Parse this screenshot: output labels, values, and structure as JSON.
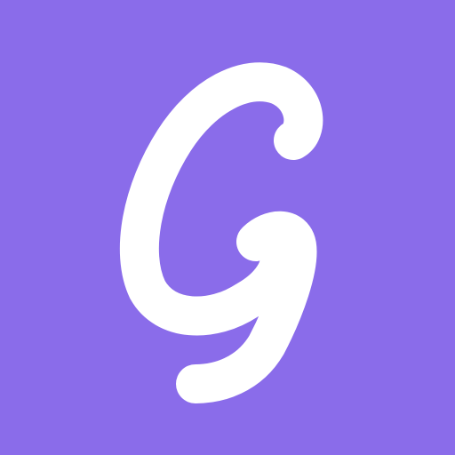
{
  "icon": {
    "glyph": "G",
    "background_color": "#8A6CEA",
    "glyph_color": "#FFFFFF"
  }
}
